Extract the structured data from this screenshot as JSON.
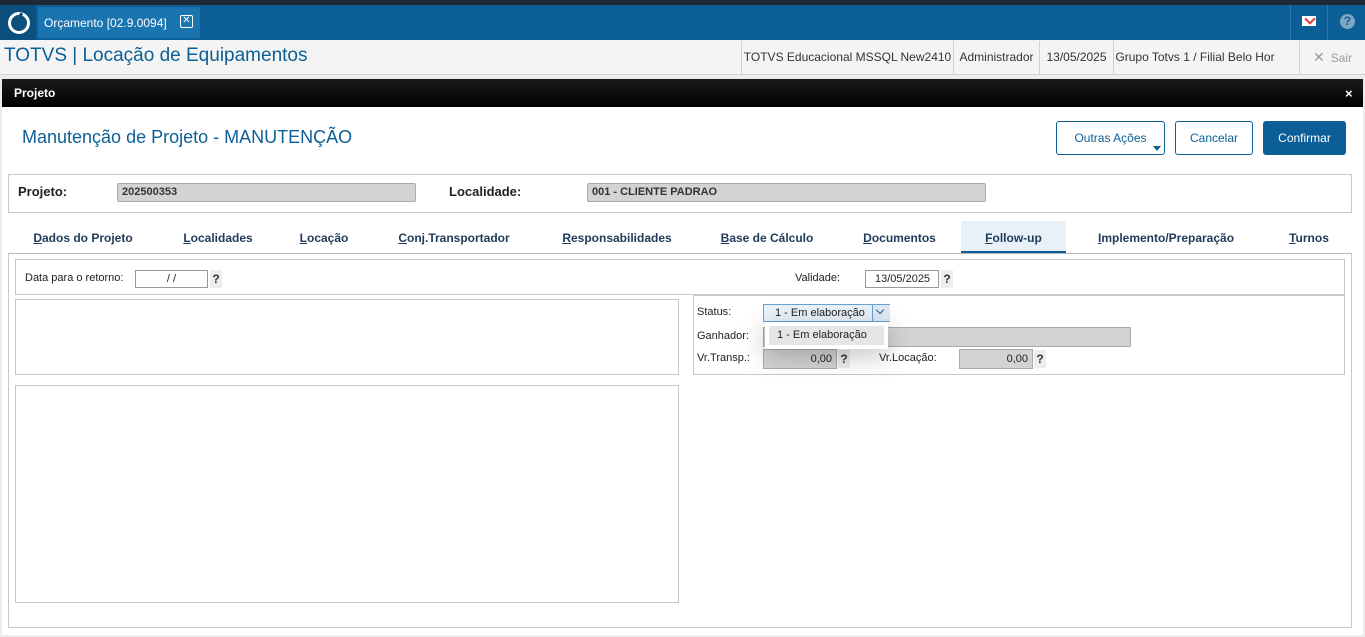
{
  "window": {
    "tab_label": "Orçamento [02.9.0094]",
    "close_glyph": "✕"
  },
  "header": {
    "app_title": "TOTVS | Locação de Equipamentos",
    "environment": "TOTVS Educacional MSSQL New2410",
    "user": "Administrador",
    "date": "13/05/2025",
    "branch": "Grupo Totvs 1 / Filial Belo Hor",
    "logout_label": "Sair"
  },
  "dialog": {
    "title": "Projeto",
    "close_glyph": "×",
    "form_title": "Manutenção de Projeto - MANUTENÇÃO",
    "buttons": {
      "other_actions": "Outras Ações",
      "cancel": "Cancelar",
      "confirm": "Confirmar"
    },
    "project_label": "Projeto:",
    "project_value": "202500353",
    "locality_label": "Localidade:",
    "locality_value": "001 - CLIENTE PADRAO"
  },
  "tabs": [
    {
      "label": "Dados do Projeto"
    },
    {
      "label": "Localidades"
    },
    {
      "label": "Locação"
    },
    {
      "label": "Conj.Transportador"
    },
    {
      "label": "Responsabilidades"
    },
    {
      "label": "Base de Cálculo"
    },
    {
      "label": "Documentos"
    },
    {
      "label": "Follow-up",
      "active": true
    },
    {
      "label": "Implemento/Preparação"
    },
    {
      "label": "Turnos"
    }
  ],
  "followup": {
    "return_date_label": "Data para o retorno:",
    "return_date_value": "/ /",
    "validity_label": "Validade:",
    "validity_value": "13/05/2025",
    "help_glyph": "?",
    "status_label": "Status:",
    "status_value": "1 - Em elaboração",
    "status_options": [
      "1 - Em elaboração"
    ],
    "winner_label": "Ganhador:",
    "winner_value": "",
    "transport_value_label": "Vr.Transp.:",
    "transport_value": "0,00",
    "rental_value_label": "Vr.Locação:",
    "rental_value": "0,00"
  },
  "colors": {
    "brand_blue": "#0c5f96",
    "top_bar": "#0c5f96",
    "dialog_bar": "#000000"
  }
}
